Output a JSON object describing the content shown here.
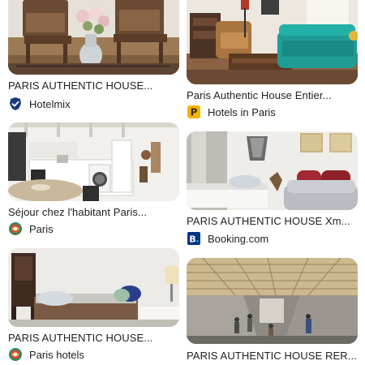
{
  "results": [
    {
      "title": "PARIS AUTHENTIC HOUSE...",
      "source": "Hotelmix",
      "source_icon": "verified-check-icon",
      "icon_color": "#1a3a78"
    },
    {
      "title": "Paris Authentic House Entier...",
      "source": "Hotels in Paris",
      "source_icon": "p-logo-icon",
      "icon_color": "#f4b400"
    },
    {
      "title": "Séjour chez l'habitant Paris...",
      "source": "Paris",
      "source_icon": "globe-logo-icon",
      "icon_color": "#2e8b57"
    },
    {
      "title": "PARIS AUTHENTIC HOUSE Xm...",
      "source": "Booking.com",
      "source_icon": "booking-b-icon",
      "icon_color": "#003580"
    },
    {
      "title": "PARIS AUTHENTIC HOUSE...",
      "source": "Paris hotels",
      "source_icon": "globe-logo-icon",
      "icon_color": "#2e8b57"
    },
    {
      "title": "PARIS AUTHENTIC HOUSE RER...",
      "source": "",
      "source_icon": "",
      "icon_color": ""
    }
  ]
}
